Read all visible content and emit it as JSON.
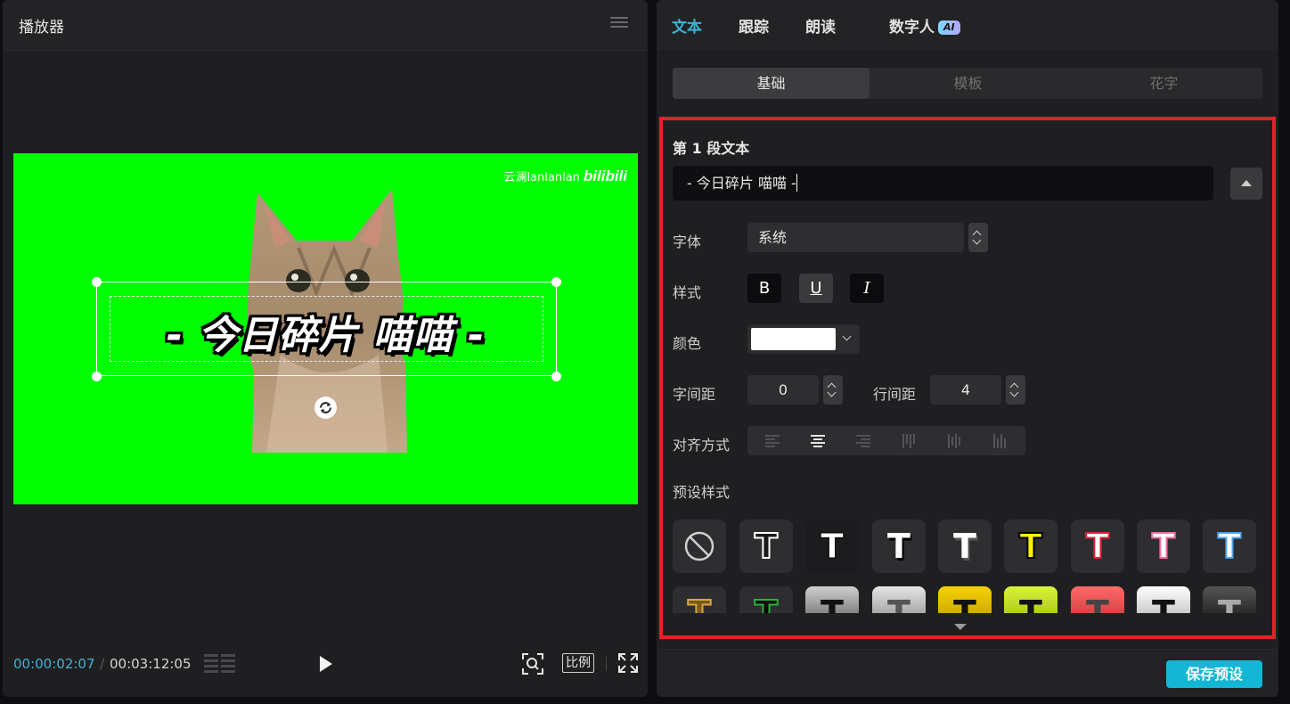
{
  "player": {
    "title": "播放器",
    "watermark_text": "云澜lanlanlan",
    "watermark_logo": "bilibili",
    "caption": "- 今日碎片 喵喵 -",
    "time_current": "00:00:02:07",
    "time_separator": "/",
    "time_total": "00:03:12:05",
    "ratio_label": "比例",
    "canvas_color": "#00ff00"
  },
  "tabs": [
    {
      "label": "文本",
      "active": true
    },
    {
      "label": "跟踪",
      "active": false
    },
    {
      "label": "朗读",
      "active": false
    },
    {
      "label": "数字人",
      "badge": "AI",
      "active": false
    }
  ],
  "subtabs": [
    {
      "label": "基础",
      "active": true
    },
    {
      "label": "模板",
      "active": false
    },
    {
      "label": "花字",
      "active": false
    }
  ],
  "text_section": {
    "title": "第 1 段文本",
    "value": "- 今日碎片 喵喵 -",
    "font_label": "字体",
    "font_value": "系统",
    "style_label": "样式",
    "bold": "B",
    "underline": "U",
    "italic": "I",
    "color_label": "颜色",
    "color_value": "#ffffff",
    "letter_spacing_label": "字间距",
    "letter_spacing_value": "0",
    "line_spacing_label": "行间距",
    "line_spacing_value": "4",
    "align_label": "对齐方式",
    "preset_label": "预设样式"
  },
  "presets_row1": [
    "none",
    "white-outline-black",
    "white-on-black",
    "white-black-shadow",
    "white-gray-shadow",
    "yellow-black-outline",
    "white-red-outline",
    "pink-outline",
    "blue-outline"
  ],
  "presets_row2": [
    "gold",
    "green",
    "gray-gradient",
    "silver-gradient",
    "yellow-gradient",
    "lime-gradient",
    "red-gradient",
    "white-gradient",
    "black-gradient"
  ],
  "footer": {
    "save_label": "保存预设"
  },
  "colors": {
    "accent": "#3fb3d6",
    "highlight_box": "#e8202a",
    "save_button": "#13b6d4"
  }
}
